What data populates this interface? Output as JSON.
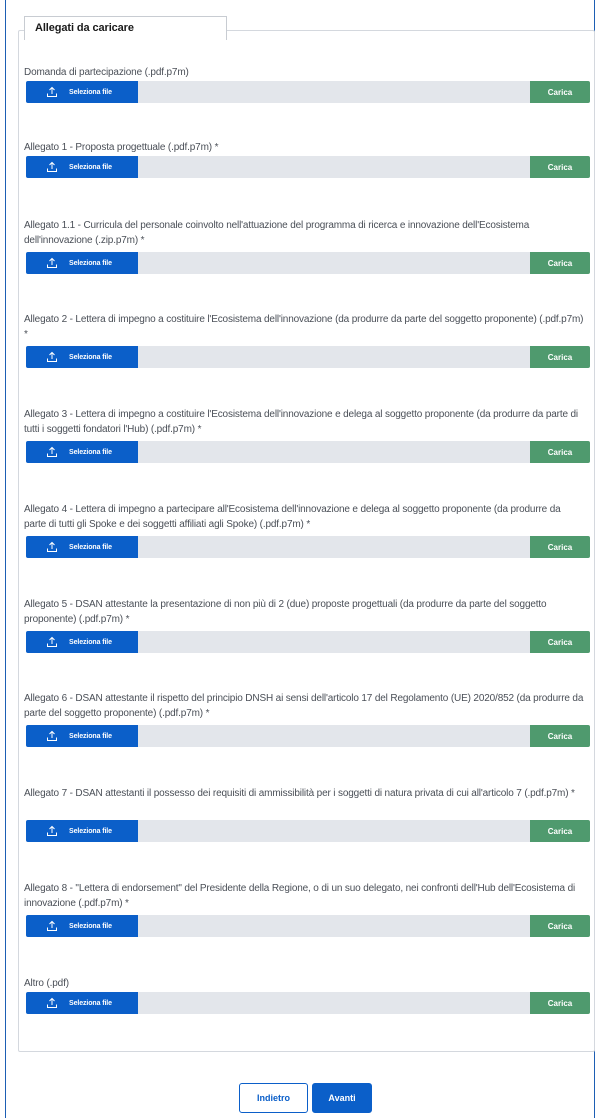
{
  "section": {
    "legend": "Allegati da caricare"
  },
  "common": {
    "select_file_label": "Seleziona file",
    "upload_label": "Carica",
    "upload_icon": "upload-icon"
  },
  "attachments": [
    {
      "label": "Domanda di partecipazione (.pdf.p7m)"
    },
    {
      "label": "Allegato 1 - Proposta progettuale (.pdf.p7m) *"
    },
    {
      "label": "Allegato 1.1 - Curricula del personale coinvolto nell'attuazione del programma di ricerca e innovazione dell'Ecosistema dell'innovazione (.zip.p7m) *"
    },
    {
      "label": "Allegato 2 - Lettera di impegno a costituire l'Ecosistema dell'innovazione (da produrre da parte del soggetto proponente) (.pdf.p7m) *"
    },
    {
      "label": "Allegato 3 - Lettera di impegno a costituire l'Ecosistema dell'innovazione e delega al soggetto proponente (da produrre da parte di tutti i soggetti fondatori l'Hub) (.pdf.p7m) *"
    },
    {
      "label": "Allegato 4 - Lettera di impegno a partecipare all'Ecosistema dell'innovazione e delega al soggetto proponente (da produrre da parte di tutti gli Spoke e dei soggetti affiliati agli Spoke) (.pdf.p7m) *"
    },
    {
      "label": "Allegato 5 - DSAN attestante la presentazione di non più di 2 (due) proposte progettuali (da produrre da parte del soggetto proponente) (.pdf.p7m) *"
    },
    {
      "label": "Allegato 6 - DSAN attestante il rispetto del principio DNSH ai sensi dell'articolo 17 del Regolamento (UE) 2020/852 (da produrre da parte del soggetto proponente) (.pdf.p7m) *"
    },
    {
      "label": "Allegato 7 - DSAN attestanti il possesso dei requisiti di ammissibilità per i soggetti di natura privata di cui all'articolo 7 (.pdf.p7m) *"
    },
    {
      "label": "Allegato 8 - \"Lettera di endorsement\" del Presidente della Regione, o di un suo delegato, nei confronti dell'Hub dell'Ecosistema di innovazione (.pdf.p7m) *"
    },
    {
      "label": "Altro (.pdf)"
    }
  ],
  "navigation": {
    "back_label": "Indietro",
    "next_label": "Avanti"
  },
  "colors": {
    "primary": "#0b5fc9",
    "upload": "#4f9a6e",
    "input_bg": "#e3e6eb"
  }
}
